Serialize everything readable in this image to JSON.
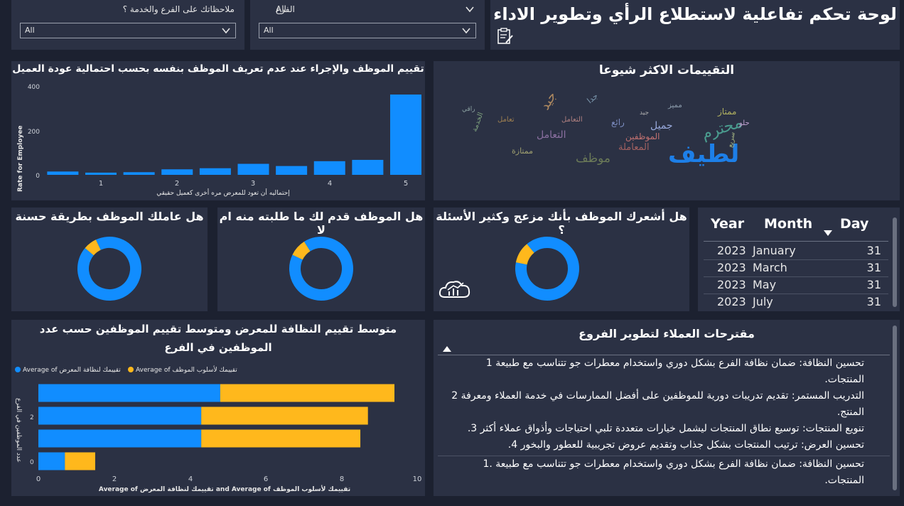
{
  "header": {
    "title": "لوحة تحكم تفاعلية لاستطلاع الرأي وتطوير الاداء",
    "icon": "survey-clipboard-icon"
  },
  "slicers": {
    "feedback": {
      "label": "ملاحظاتك على الفرع والخدمة ؟",
      "value": "All"
    },
    "branch": {
      "label": "الفرع",
      "value": "All"
    }
  },
  "bar_chart": {
    "title": "تقييم الموظف والإجراء عند عدم تعريف الموظف بنفسه بحسب احتمالية عودة العميل",
    "xlabel": "إحتماليه أن تعود للمعرض مره أخرى كعميل حقيقي",
    "ylabel": "Rate for Employee",
    "y_ticks": [
      "400",
      "200",
      "0"
    ],
    "x_ticks": [
      "1",
      "2",
      "3",
      "4",
      "5"
    ]
  },
  "wordcloud": {
    "title": "التقييمات الاكثر شيوعا",
    "words": [
      "لطيف",
      "محترم",
      "موظف",
      "جميل",
      "التعامل",
      "المعاملة",
      "ممتاز",
      "جيد",
      "رائع",
      "الموظفين",
      "الخدمة",
      "تعامل",
      "مميز",
      "حلو",
      "ممتازة",
      "جدا",
      "التعامل",
      "راقي",
      "سريع",
      "جيد"
    ]
  },
  "donuts": [
    {
      "title": "هل عاملك الموظف بطريقة حسنة",
      "yes_share": 0.93
    },
    {
      "title": "هل الموظف قدم لك ما طلبته منه ام لا",
      "yes_share": 0.91
    },
    {
      "title": "هل أشعرك الموظف بأنك مزعج وكثير الأسئلة ؟",
      "yes_share": 0.89
    }
  ],
  "date_table": {
    "headers": [
      "Year",
      "Month",
      "Day"
    ],
    "rows": [
      [
        "2023",
        "January",
        "31"
      ],
      [
        "2023",
        "March",
        "31"
      ],
      [
        "2023",
        "May",
        "31"
      ],
      [
        "2023",
        "July",
        "31"
      ]
    ]
  },
  "hbar_chart": {
    "title_line1": "متوسط تقييم النظافة للمعرض ومتوسط تقييم الموظفين حسب عدد",
    "title_line2": "الموظفين في الفرع",
    "legend": [
      {
        "name": "Average of تقييمك لنظافة المعرض",
        "color": "#118dff"
      },
      {
        "name": "Average of تقييمك لأسلوب الموظف",
        "color": "#ffb81c"
      }
    ],
    "xlabel": "Average of تقييمك لنظافة المعرض and Average of تقييمك لأسلوب الموظف",
    "ylabel": "عدد الموظفين في الفرع",
    "x_ticks": [
      "0",
      "2",
      "4",
      "6",
      "8",
      "10"
    ],
    "y_ticks": [
      "2",
      "0"
    ]
  },
  "suggestions": {
    "title": "مقترحات العملاء لتطوير الفروع",
    "lines": [
      "تحسين النظافة: ضمان نظافة الفرع بشكل دوري واستخدام معطرات جو تتناسب مع طبيعة 1",
      "المنتجات.",
      "التدريب المستمر: تقديم تدريبات دورية للموظفين على أفضل الممارسات في خدمة العملاء ومعرفة 2",
      "المنتج.",
      "تنويع المنتجات: توسيع نطاق المنتجات ليشمل خيارات متعددة تلبي احتياجات وأذواق عملاء أكثر 3.",
      "تحسين العرض: ترتيب المنتجات بشكل جذاب وتقديم عروض تجريبية للعطور والبخور 4.",
      "تحسين النظافة: ضمان نظافة الفرع بشكل دوري واستخدام معطرات جو تتناسب مع طبيعة .1",
      "المنتجات."
    ]
  },
  "chart_data": [
    {
      "type": "bar",
      "title": "تقييم الموظف والإجراء عند عدم تعريف الموظف بنفسه بحسب احتمالية عودة العميل",
      "xlabel": "إحتماليه أن تعود للمعرض مره أخرى كعميل حقيقي",
      "ylabel": "Rate for Employee",
      "x": [
        0.5,
        1,
        1.5,
        2,
        2.5,
        3,
        3.5,
        4,
        4.5,
        5
      ],
      "values": [
        15,
        10,
        12,
        25,
        30,
        50,
        40,
        62,
        68,
        365
      ],
      "ylim": [
        0,
        420
      ],
      "color": "#118dff"
    },
    {
      "type": "bar",
      "orientation": "horizontal",
      "title": "متوسط تقييم النظافة للمعرض ومتوسط تقييم الموظفين حسب عدد الموظفين في الفرع",
      "categories": [
        "3",
        "2",
        "1",
        "0"
      ],
      "series": [
        {
          "name": "Average of تقييمك لنظافة المعرض",
          "values": [
            4.8,
            4.3,
            4.3,
            0.7
          ]
        },
        {
          "name": "Average of تقييمك لأسلوب الموظف",
          "values": [
            4.6,
            4.4,
            4.2,
            0.8
          ]
        }
      ],
      "stacked": true,
      "xlim": [
        0,
        10
      ]
    },
    {
      "type": "pie",
      "donut": true,
      "charts": [
        {
          "title": "هل عاملك الموظف بطريقة حسنة",
          "values": [
            0.93,
            0.07
          ],
          "colors": [
            "#118dff",
            "#ffb81c"
          ]
        },
        {
          "title": "هل الموظف قدم لك ما طلبته منه ام لا",
          "values": [
            0.91,
            0.09
          ],
          "colors": [
            "#118dff",
            "#ffb81c"
          ]
        },
        {
          "title": "هل أشعرك الموظف بأنك مزعج وكثير الأسئلة ؟",
          "values": [
            0.89,
            0.11
          ],
          "colors": [
            "#118dff",
            "#ffb81c"
          ]
        }
      ]
    }
  ]
}
